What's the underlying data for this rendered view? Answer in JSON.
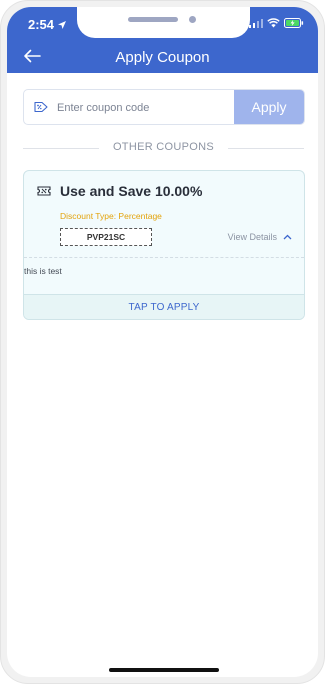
{
  "colors": {
    "header_bg": "#3d67cd",
    "apply_button_bg": "#9fb4ec",
    "discount_type_text": "#e3a30c",
    "card_bg": "#f2fbfd",
    "tap_text": "#3d67cd"
  },
  "status_bar": {
    "time": "2:54",
    "icons": [
      "location-arrow-icon",
      "signal-icon",
      "wifi-icon",
      "battery-charging-icon"
    ]
  },
  "header": {
    "title": "Apply Coupon",
    "back_icon": "back-arrow-icon"
  },
  "coupon_entry": {
    "placeholder": "Enter coupon code",
    "value": "",
    "apply_label": "Apply",
    "icon": "tag-icon"
  },
  "section_divider": {
    "label": "OTHER COUPONS"
  },
  "coupons": [
    {
      "title": "Use and Save 10.00%",
      "discount_type": "Discount Type: Percentage",
      "code": "PVP21SC",
      "view_details": "View Details",
      "description": "this is test",
      "tap_label": "TAP TO APPLY",
      "icon": "coupon-ticket-icon"
    }
  ]
}
